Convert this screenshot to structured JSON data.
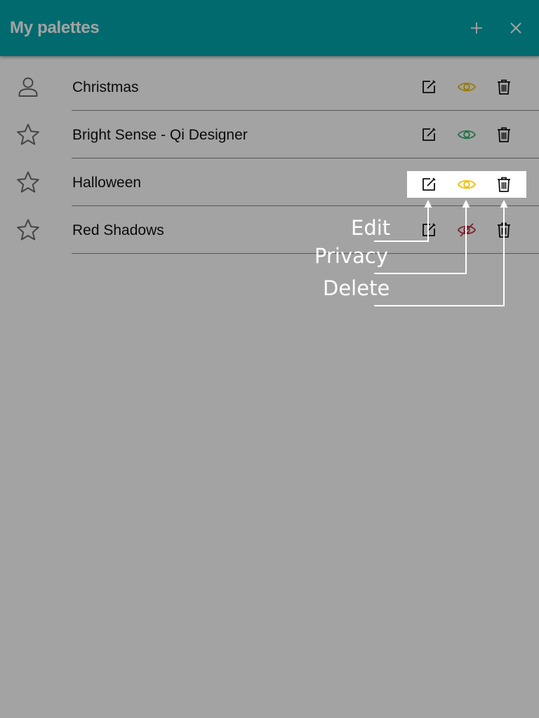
{
  "header": {
    "title": "My palettes",
    "add_icon": "plus-icon",
    "close_icon": "close-icon",
    "background": "#00a6ad"
  },
  "palettes": [
    {
      "name": "Christmas",
      "lead_icon": "user-icon",
      "privacy_icon": "eye-icon",
      "privacy_color": "#f0c000"
    },
    {
      "name": "Bright Sense - Qi Designer",
      "lead_icon": "star-icon",
      "privacy_icon": "eye-icon",
      "privacy_color": "#3cb371"
    },
    {
      "name": "Halloween",
      "lead_icon": "star-icon",
      "privacy_icon": "eye-icon",
      "privacy_color": "#f0c000"
    },
    {
      "name": "Red Shadows",
      "lead_icon": "star-icon",
      "privacy_icon": "eye-off-icon",
      "privacy_color": "#c0364a"
    }
  ],
  "action_icons": {
    "edit": "edit-icon",
    "delete": "trash-icon"
  },
  "callouts": {
    "edit": "Edit",
    "privacy": "Privacy",
    "delete": "Delete"
  }
}
